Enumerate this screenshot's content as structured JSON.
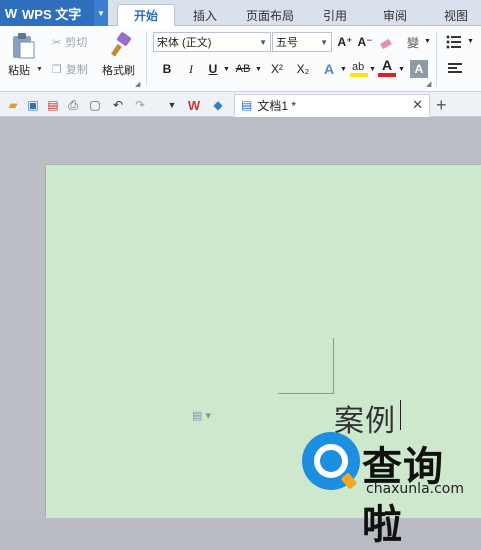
{
  "app": {
    "name": "WPS 文字"
  },
  "tabs": [
    "开始",
    "插入",
    "页面布局",
    "引用",
    "审阅",
    "视图"
  ],
  "ribbon": {
    "paste_label": "粘贴",
    "cut_label": "剪切",
    "copy_label": "复制",
    "format_painter_label": "格式刷",
    "font_name": "宋体 (正文)",
    "font_size": "五号",
    "bold": "B",
    "italic": "I",
    "underline": "U",
    "strike": "AB",
    "superscript": "X²",
    "subscript": "X₂",
    "grow_font": "A⁺",
    "shrink_font": "A⁻",
    "font_color_letter": "A",
    "phonetic": "變"
  },
  "doc_tab": {
    "title": "文档1 *"
  },
  "document": {
    "text": "案例"
  },
  "watermark": {
    "cn": "查询啦",
    "url": "chaxunla.com"
  },
  "colors": {
    "accent": "#2f6fbe",
    "page_bg": "#cde8cc",
    "highlight": "#ffe600",
    "font_color": "#e02020"
  }
}
